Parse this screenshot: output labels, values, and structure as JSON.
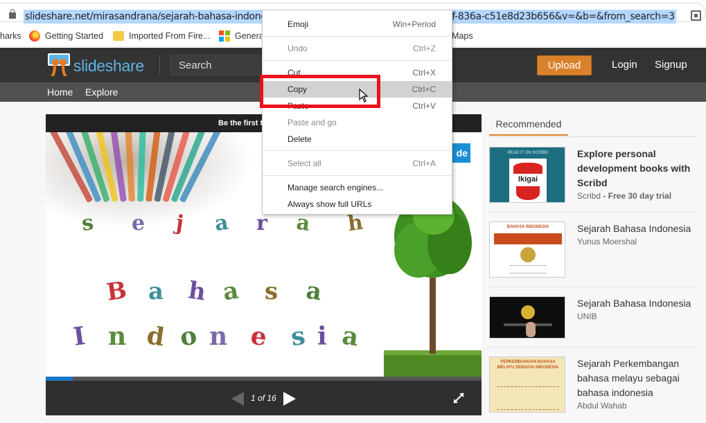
{
  "browser": {
    "url": "slideshare.net/mirasandrana/sejarah-bahasa-indonesia-53134751?qid=0e6a628b-1a94-485f-836a-c51e8d23b656&v=&b=&from_search=3",
    "bookmarks": [
      {
        "label": "harks",
        "icon": "bookmarks-icon"
      },
      {
        "label": "Getting Started",
        "icon": "firefox-icon"
      },
      {
        "label": "Imported From Fire...",
        "icon": "folder-icon"
      },
      {
        "label": "Genera",
        "icon": "microsoft-icon"
      },
      {
        "label": "Maps",
        "icon": "maps-icon"
      }
    ]
  },
  "context_menu": {
    "items": [
      {
        "label": "Emoji",
        "shortcut": "Win+Period",
        "enabled": true
      },
      {
        "label": "Undo",
        "shortcut": "Ctrl+Z",
        "enabled": false
      },
      {
        "label": "Cut",
        "shortcut": "Ctrl+X",
        "enabled": true
      },
      {
        "label": "Copy",
        "shortcut": "Ctrl+C",
        "enabled": true,
        "highlighted": true
      },
      {
        "label": "Paste",
        "shortcut": "Ctrl+V",
        "enabled": true
      },
      {
        "label": "Paste and go",
        "shortcut": "",
        "enabled": false
      },
      {
        "label": "Delete",
        "shortcut": "",
        "enabled": true
      },
      {
        "label": "Select all",
        "shortcut": "Ctrl+A",
        "enabled": false
      },
      {
        "label": "Manage search engines...",
        "shortcut": "",
        "enabled": true
      },
      {
        "label": "Always show full URLs",
        "shortcut": "",
        "enabled": true
      }
    ],
    "highlight_color": "#e8121b"
  },
  "header": {
    "logo_text": "slideshare",
    "search_placeholder": "Search",
    "upload_label": "Upload",
    "login_label": "Login",
    "signup_label": "Signup",
    "accent": "#d9822b"
  },
  "subnav": {
    "home_label": "Home",
    "explore_label": "Explore"
  },
  "player": {
    "top_banner": "Be the first to like this",
    "download_label": "de",
    "current_page": 1,
    "total_pages": 16,
    "page_indicator": "1 of 16",
    "progress": 0.0625,
    "slide_lines": [
      {
        "word": "sejarah",
        "letters": [
          "s",
          "e",
          "j",
          "a",
          "r",
          "a",
          "h"
        ]
      },
      {
        "word": "Bahasa",
        "letters": [
          "B",
          "a",
          "h",
          "a",
          "s",
          "a"
        ]
      },
      {
        "word": "Indonesia",
        "letters": [
          "I",
          "n",
          "d",
          "o",
          "n",
          "e",
          "s",
          "i",
          "a"
        ]
      }
    ]
  },
  "recommended": {
    "tab_label": "Recommended",
    "items": [
      {
        "title": "Explore personal development books with Scribd",
        "author": "Scribd",
        "author_suffix": " - Free 30 day trial",
        "thumb_text": "Ikigai",
        "thumb_brand": "READ IT ON SCRIBD",
        "bold": true
      },
      {
        "title": "Sejarah Bahasa Indonesia",
        "author": "Yunus Moershal",
        "thumb_text": "BAHASA INDONESIA",
        "bold": false
      },
      {
        "title": "Sejarah Bahasa Indonesia",
        "author": "UNIB",
        "thumb_text": "",
        "bold": false
      },
      {
        "title": "Sejarah Perkembangan bahasa melayu sebagai bahasa indonesia",
        "author": "Abdul Wahab",
        "thumb_text": "PERKEMBANGAN BAHASA MELAYU SEBAGAI INDONESIA",
        "bold": false
      }
    ]
  }
}
